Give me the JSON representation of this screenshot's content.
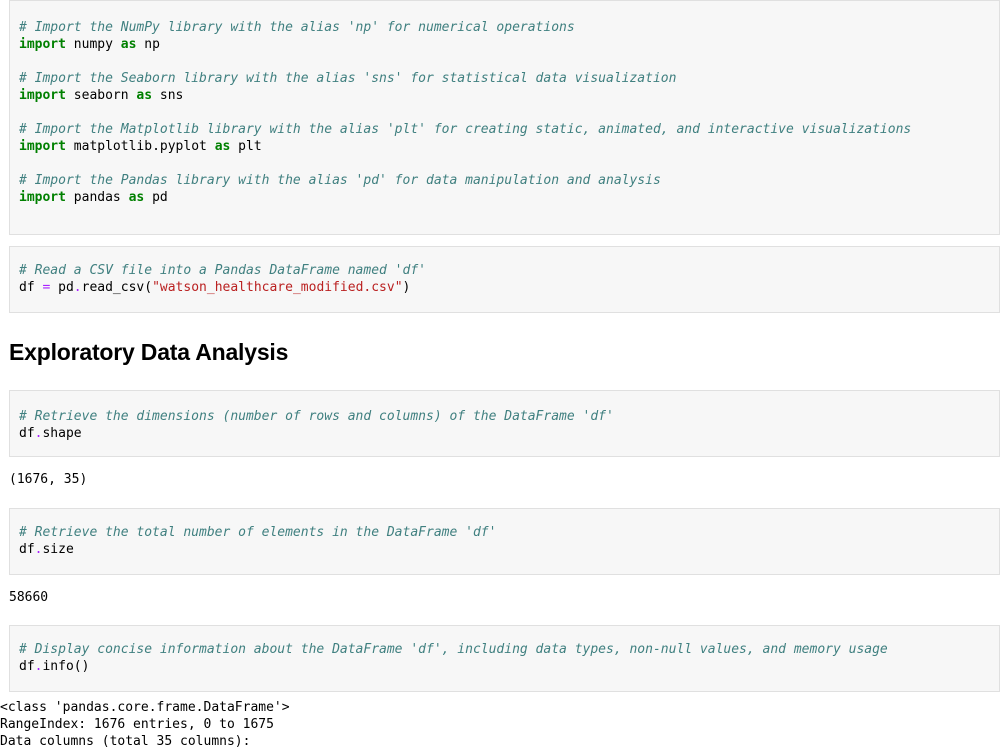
{
  "cells": {
    "c1": {
      "comment_numpy": "# Import the NumPy library with the alias 'np' for numerical operations",
      "import_kw": "import",
      "as_kw": "as",
      "mod_numpy": "numpy",
      "alias_numpy": "np",
      "comment_seaborn": "# Import the Seaborn library with the alias 'sns' for statistical data visualization",
      "mod_seaborn": "seaborn",
      "alias_seaborn": "sns",
      "comment_mpl": "# Import the Matplotlib library with the alias 'plt' for creating static, animated, and interactive visualizations",
      "mod_mpl": "matplotlib.pyplot",
      "alias_mpl": "plt",
      "comment_pandas": "# Import the Pandas library with the alias 'pd' for data manipulation and analysis",
      "mod_pandas": "pandas",
      "alias_pandas": "pd"
    },
    "c2": {
      "comment": "# Read a CSV file into a Pandas DataFrame named 'df'",
      "lhs": "df",
      "eq": "=",
      "call_pre": "pd",
      "dot": ".",
      "call_fn": "read_csv(",
      "arg": "\"watson_healthcare_modified.csv\"",
      "close": ")"
    },
    "c3": {
      "comment": "# Retrieve the dimensions (number of rows and columns) of the DataFrame 'df'",
      "obj": "df",
      "dot": ".",
      "attr": "shape"
    },
    "c4": {
      "comment": "# Retrieve the total number of elements in the DataFrame 'df'",
      "obj": "df",
      "dot": ".",
      "attr": "size"
    },
    "c5": {
      "comment": "# Display concise information about the DataFrame 'df', including data types, non-null values, and memory usage",
      "obj": "df",
      "dot": ".",
      "attr": "info",
      "parens": "()"
    }
  },
  "heading": "Exploratory Data Analysis",
  "outputs": {
    "shape": "(1676, 35)",
    "size": "58660",
    "info_line1": "<class 'pandas.core.frame.DataFrame'>",
    "info_line2": "RangeIndex: 1676 entries, 0 to 1675",
    "info_line3": "Data columns (total 35 columns):"
  }
}
